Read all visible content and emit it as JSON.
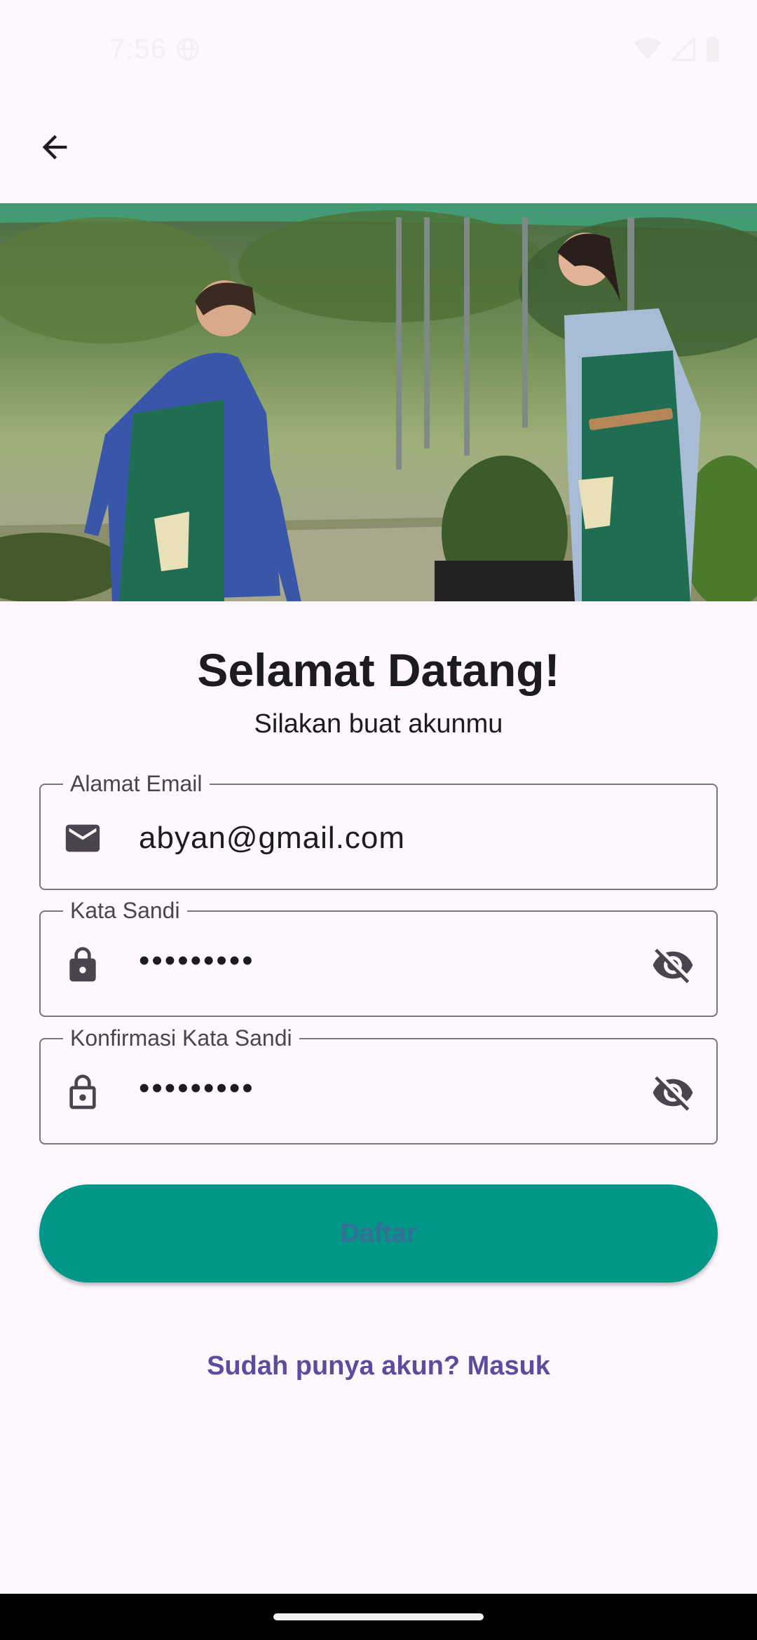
{
  "status_bar": {
    "time": "7:56",
    "icons": [
      "globe-icon",
      "wifi-icon",
      "signal-icon",
      "battery-icon"
    ]
  },
  "app_bar": {
    "back_icon": "arrow-back-icon"
  },
  "hero": {
    "description_icon": "hero-photo"
  },
  "heading": {
    "title": "Selamat Datang!",
    "subtitle": "Silakan buat akunmu"
  },
  "form": {
    "email": {
      "label": "Alamat Email",
      "value": "abyan@gmail.com",
      "icon": "mail-icon"
    },
    "password": {
      "label": "Kata Sandi",
      "value": "•••••••••",
      "icon": "lock-icon",
      "trailing_icon": "visibility-off-icon"
    },
    "confirm_password": {
      "label": "Konfirmasi Kata Sandi",
      "value": "•••••••••",
      "icon": "lock-outline-icon",
      "trailing_icon": "visibility-off-icon"
    }
  },
  "actions": {
    "register_label": "Daftar",
    "login_link": "Sudah punya akun? Masuk"
  },
  "colors": {
    "background": "#fef7fd",
    "primary_button": "#009688",
    "link": "#5e4ba0",
    "outline": "#79747e"
  }
}
